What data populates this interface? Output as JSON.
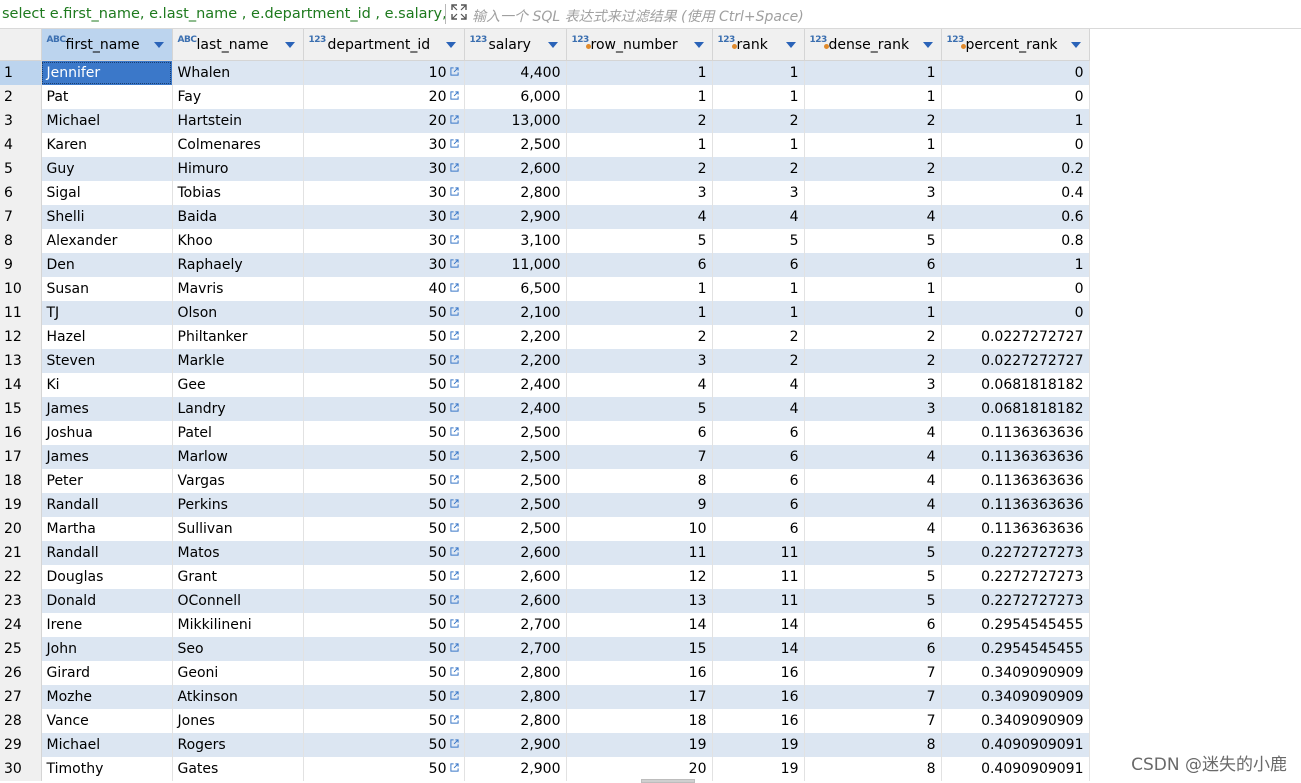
{
  "filter": {
    "sql": "select e.first_name, e.last_name , e.department_id , e.salary, r",
    "placeholder": "输入一个 SQL 表达式来过滤结果 (使用 Ctrl+Space)"
  },
  "columns": [
    {
      "name": "first_name",
      "type_icon": "ABC",
      "ref": false
    },
    {
      "name": "last_name",
      "type_icon": "ABC",
      "ref": false
    },
    {
      "name": "department_id",
      "type_icon": "123",
      "ref": false
    },
    {
      "name": "salary",
      "type_icon": "123",
      "ref": false
    },
    {
      "name": "row_number",
      "type_icon": "123",
      "ref": true
    },
    {
      "name": "rank",
      "type_icon": "123",
      "ref": true
    },
    {
      "name": "dense_rank",
      "type_icon": "123",
      "ref": true
    },
    {
      "name": "percent_rank",
      "type_icon": "123",
      "ref": true
    }
  ],
  "rows": [
    [
      "1",
      "Jennifer",
      "Whalen",
      "10",
      "4,400",
      "1",
      "1",
      "1",
      "0"
    ],
    [
      "2",
      "Pat",
      "Fay",
      "20",
      "6,000",
      "1",
      "1",
      "1",
      "0"
    ],
    [
      "3",
      "Michael",
      "Hartstein",
      "20",
      "13,000",
      "2",
      "2",
      "2",
      "1"
    ],
    [
      "4",
      "Karen",
      "Colmenares",
      "30",
      "2,500",
      "1",
      "1",
      "1",
      "0"
    ],
    [
      "5",
      "Guy",
      "Himuro",
      "30",
      "2,600",
      "2",
      "2",
      "2",
      "0.2"
    ],
    [
      "6",
      "Sigal",
      "Tobias",
      "30",
      "2,800",
      "3",
      "3",
      "3",
      "0.4"
    ],
    [
      "7",
      "Shelli",
      "Baida",
      "30",
      "2,900",
      "4",
      "4",
      "4",
      "0.6"
    ],
    [
      "8",
      "Alexander",
      "Khoo",
      "30",
      "3,100",
      "5",
      "5",
      "5",
      "0.8"
    ],
    [
      "9",
      "Den",
      "Raphaely",
      "30",
      "11,000",
      "6",
      "6",
      "6",
      "1"
    ],
    [
      "10",
      "Susan",
      "Mavris",
      "40",
      "6,500",
      "1",
      "1",
      "1",
      "0"
    ],
    [
      "11",
      "TJ",
      "Olson",
      "50",
      "2,100",
      "1",
      "1",
      "1",
      "0"
    ],
    [
      "12",
      "Hazel",
      "Philtanker",
      "50",
      "2,200",
      "2",
      "2",
      "2",
      "0.0227272727"
    ],
    [
      "13",
      "Steven",
      "Markle",
      "50",
      "2,200",
      "3",
      "2",
      "2",
      "0.0227272727"
    ],
    [
      "14",
      "Ki",
      "Gee",
      "50",
      "2,400",
      "4",
      "4",
      "3",
      "0.0681818182"
    ],
    [
      "15",
      "James",
      "Landry",
      "50",
      "2,400",
      "5",
      "4",
      "3",
      "0.0681818182"
    ],
    [
      "16",
      "Joshua",
      "Patel",
      "50",
      "2,500",
      "6",
      "6",
      "4",
      "0.1136363636"
    ],
    [
      "17",
      "James",
      "Marlow",
      "50",
      "2,500",
      "7",
      "6",
      "4",
      "0.1136363636"
    ],
    [
      "18",
      "Peter",
      "Vargas",
      "50",
      "2,500",
      "8",
      "6",
      "4",
      "0.1136363636"
    ],
    [
      "19",
      "Randall",
      "Perkins",
      "50",
      "2,500",
      "9",
      "6",
      "4",
      "0.1136363636"
    ],
    [
      "20",
      "Martha",
      "Sullivan",
      "50",
      "2,500",
      "10",
      "6",
      "4",
      "0.1136363636"
    ],
    [
      "21",
      "Randall",
      "Matos",
      "50",
      "2,600",
      "11",
      "11",
      "5",
      "0.2272727273"
    ],
    [
      "22",
      "Douglas",
      "Grant",
      "50",
      "2,600",
      "12",
      "11",
      "5",
      "0.2272727273"
    ],
    [
      "23",
      "Donald",
      "OConnell",
      "50",
      "2,600",
      "13",
      "11",
      "5",
      "0.2272727273"
    ],
    [
      "24",
      "Irene",
      "Mikkilineni",
      "50",
      "2,700",
      "14",
      "14",
      "6",
      "0.2954545455"
    ],
    [
      "25",
      "John",
      "Seo",
      "50",
      "2,700",
      "15",
      "14",
      "6",
      "0.2954545455"
    ],
    [
      "26",
      "Girard",
      "Geoni",
      "50",
      "2,800",
      "16",
      "16",
      "7",
      "0.3409090909"
    ],
    [
      "27",
      "Mozhe",
      "Atkinson",
      "50",
      "2,800",
      "17",
      "16",
      "7",
      "0.3409090909"
    ],
    [
      "28",
      "Vance",
      "Jones",
      "50",
      "2,800",
      "18",
      "16",
      "7",
      "0.3409090909"
    ],
    [
      "29",
      "Michael",
      "Rogers",
      "50",
      "2,900",
      "19",
      "19",
      "8",
      "0.4090909091"
    ],
    [
      "30",
      "Timothy",
      "Gates",
      "50",
      "2,900",
      "20",
      "19",
      "8",
      "0.4090909091"
    ]
  ],
  "watermark": "CSDN @迷失的小鹿",
  "colors": {
    "selection": "#3b78c9",
    "stripe": "#dce6f2",
    "sql_text": "#1e7a1e",
    "header_bg": "#f0f0f0"
  }
}
